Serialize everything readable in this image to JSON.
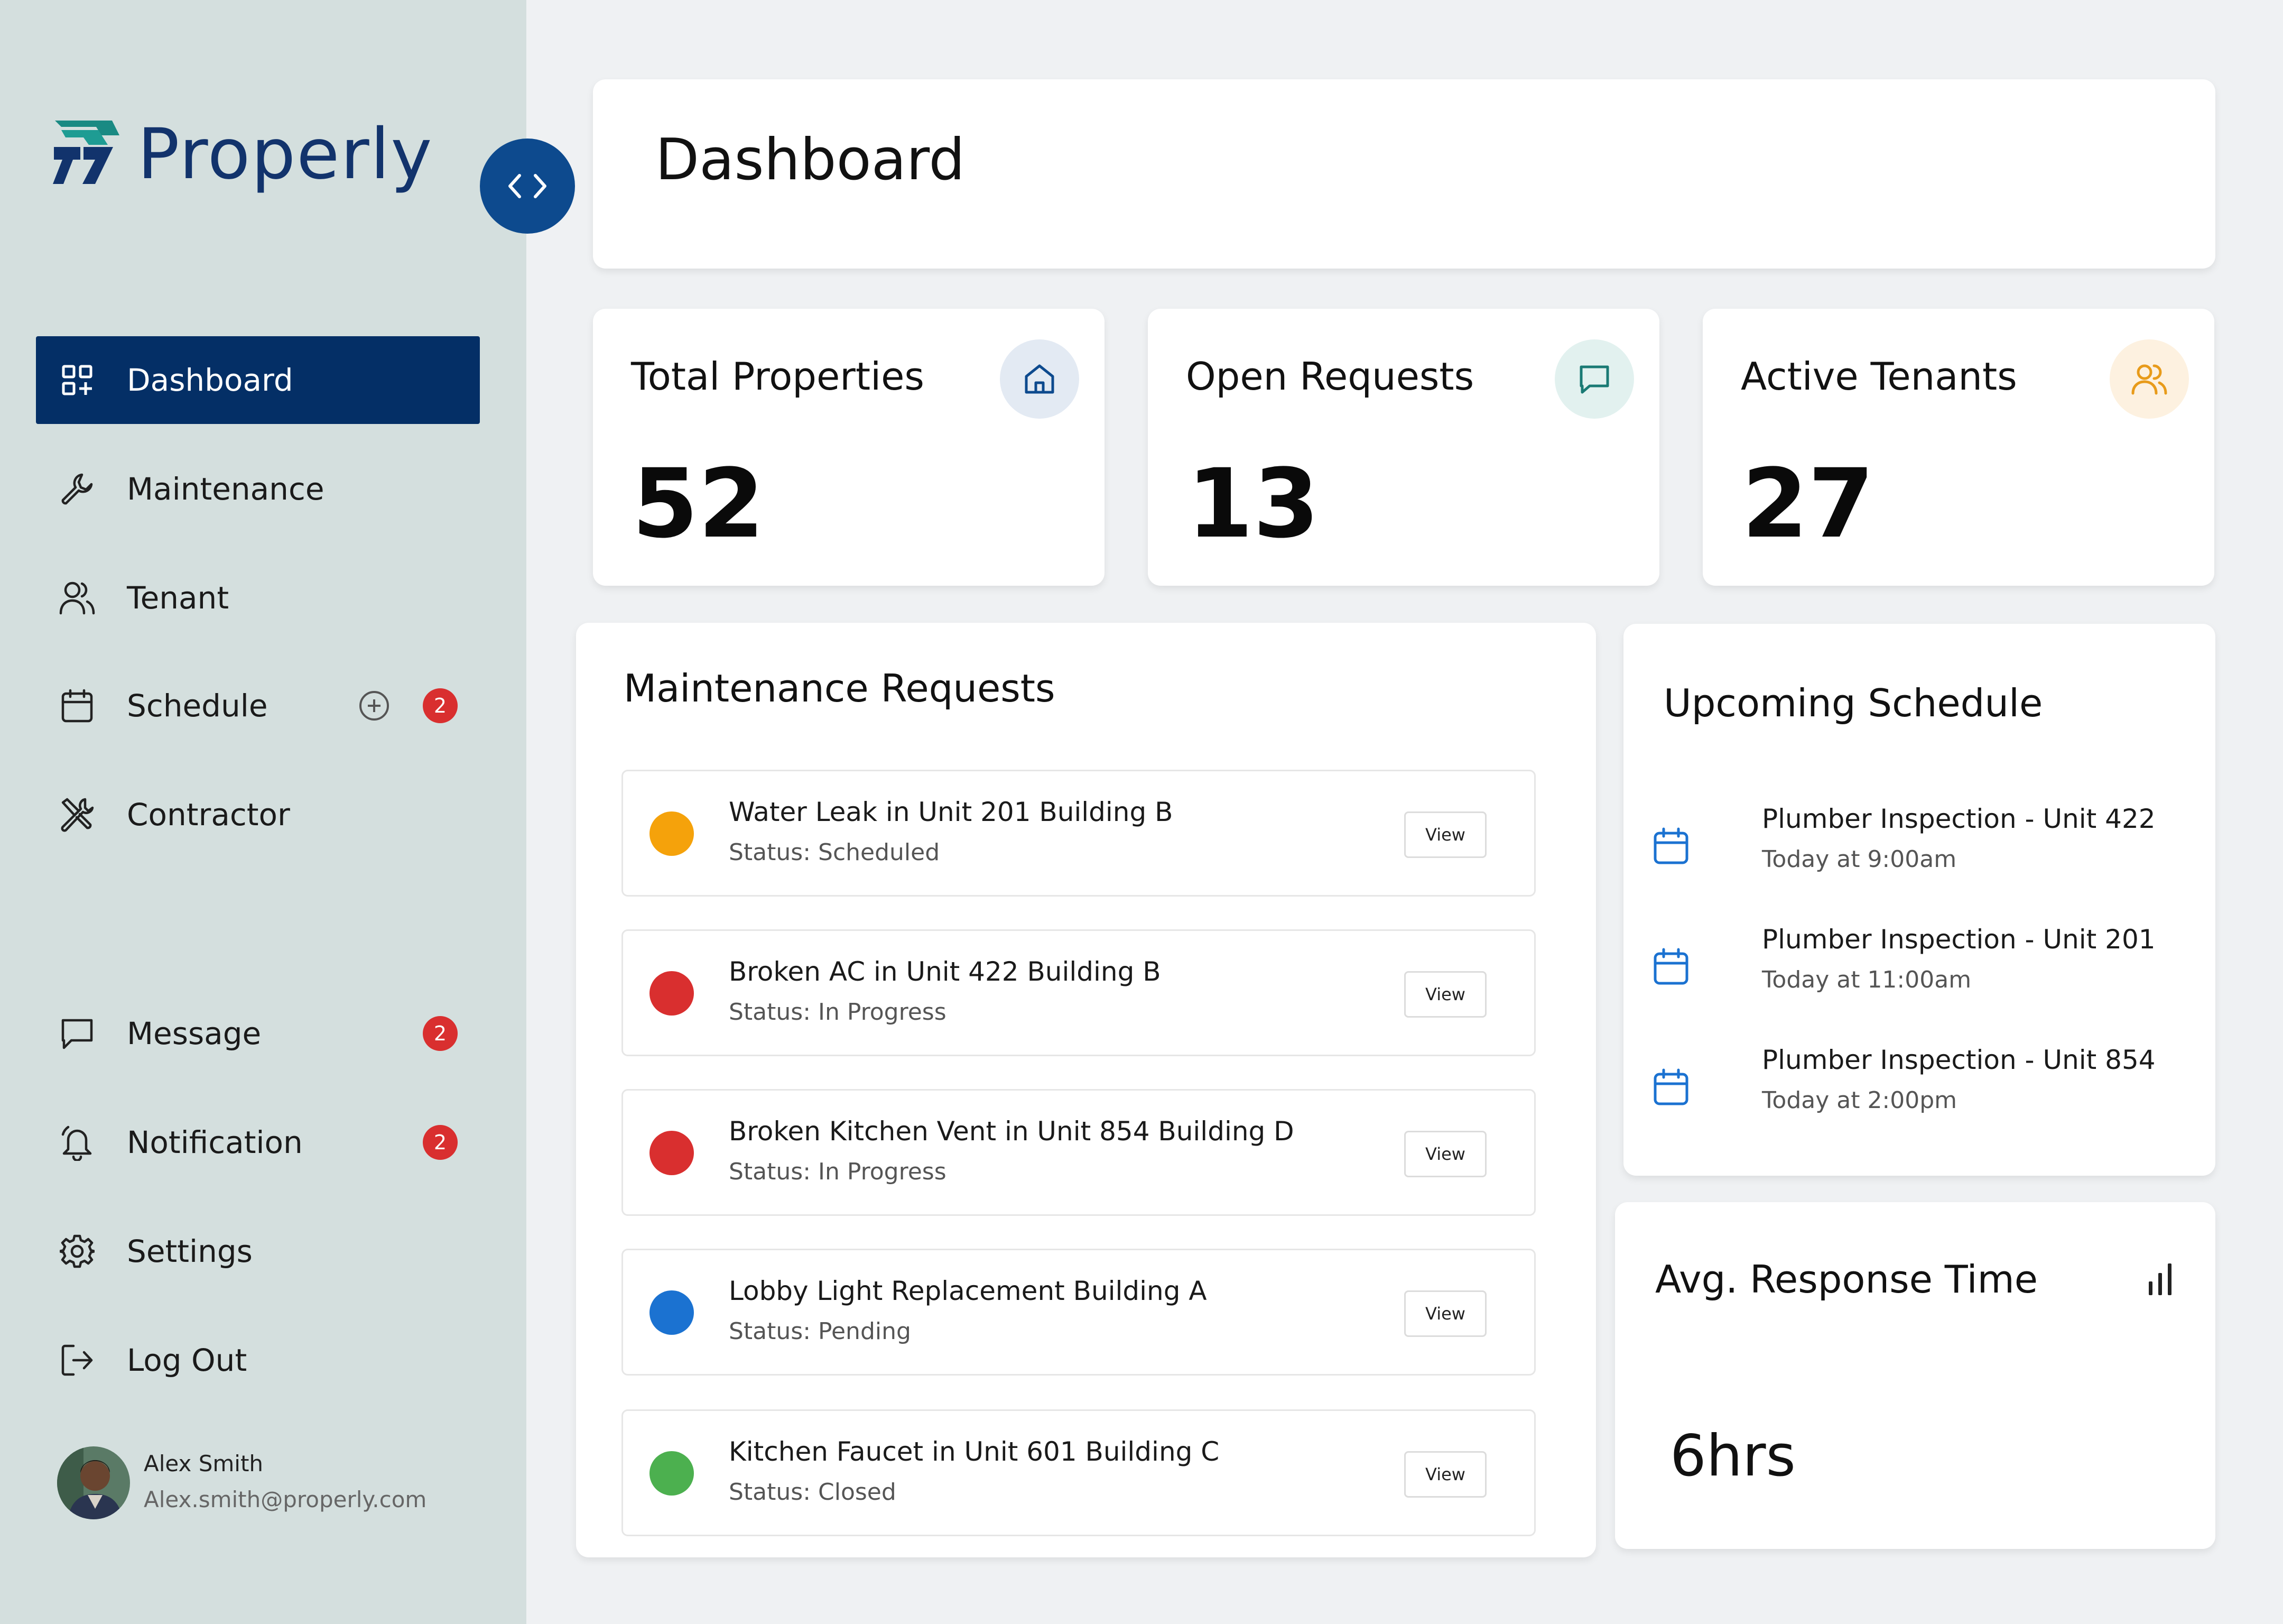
{
  "app": {
    "name": "Properly",
    "brand_color": "#12336c",
    "accent_color": "#042f66"
  },
  "sidebar": {
    "items": [
      {
        "label": "Dashboard",
        "icon": "dashboard-icon",
        "active": true
      },
      {
        "label": "Maintenance",
        "icon": "wrench-icon"
      },
      {
        "label": "Tenant",
        "icon": "user-icon"
      },
      {
        "label": "Schedule",
        "icon": "calendar-icon",
        "badge": "2",
        "has_add": true
      },
      {
        "label": "Contractor",
        "icon": "tools-icon"
      },
      {
        "label": "Message",
        "icon": "message-icon",
        "badge": "2"
      },
      {
        "label": "Notification",
        "icon": "bell-icon",
        "badge": "2"
      },
      {
        "label": "Settings",
        "icon": "gear-icon"
      },
      {
        "label": "Log Out",
        "icon": "logout-icon"
      }
    ],
    "user": {
      "name": "Alex Smith",
      "email": "Alex.smith@properly.com"
    }
  },
  "header": {
    "title": "Dashboard"
  },
  "stats": [
    {
      "label": "Total Properties",
      "value": "52",
      "icon": "home-icon",
      "icon_color": "#0d4a8e",
      "icon_bg": "#e3eaf3"
    },
    {
      "label": "Open Requests",
      "value": "13",
      "icon": "chat-icon",
      "icon_color": "#1a7a74",
      "icon_bg": "#e2f1ef"
    },
    {
      "label": "Active Tenants",
      "value": "27",
      "icon": "users-icon",
      "icon_color": "#e89b1a",
      "icon_bg": "#fdf1e0"
    }
  ],
  "maintenance": {
    "title": "Maintenance Requests",
    "view_label": "View",
    "requests": [
      {
        "title": "Water Leak in Unit 201 Building B",
        "status": "Status: Scheduled",
        "color": "#f5a20b"
      },
      {
        "title": "Broken AC in Unit 422 Building B",
        "status": "Status:  In Progress",
        "color": "#d92f2f"
      },
      {
        "title": "Broken Kitchen Vent in Unit 854 Building D",
        "status": "Status:  In Progress",
        "color": "#d92f2f"
      },
      {
        "title": "Lobby Light Replacement Building A",
        "status": "Status:  Pending",
        "color": "#1b72d1"
      },
      {
        "title": "Kitchen Faucet in Unit 601 Building C",
        "status": "Status:  Closed",
        "color": "#4cb04f"
      }
    ]
  },
  "schedule": {
    "title": "Upcoming Schedule",
    "items": [
      {
        "title": "Plumber Inspection - Unit 422",
        "time": "Today at 9:00am"
      },
      {
        "title": "Plumber Inspection - Unit 201",
        "time": "Today at 11:00am"
      },
      {
        "title": "Plumber Inspection - Unit 854",
        "time": "Today at 2:00pm"
      }
    ]
  },
  "response": {
    "title": "Avg. Response Time",
    "value": "6hrs"
  }
}
